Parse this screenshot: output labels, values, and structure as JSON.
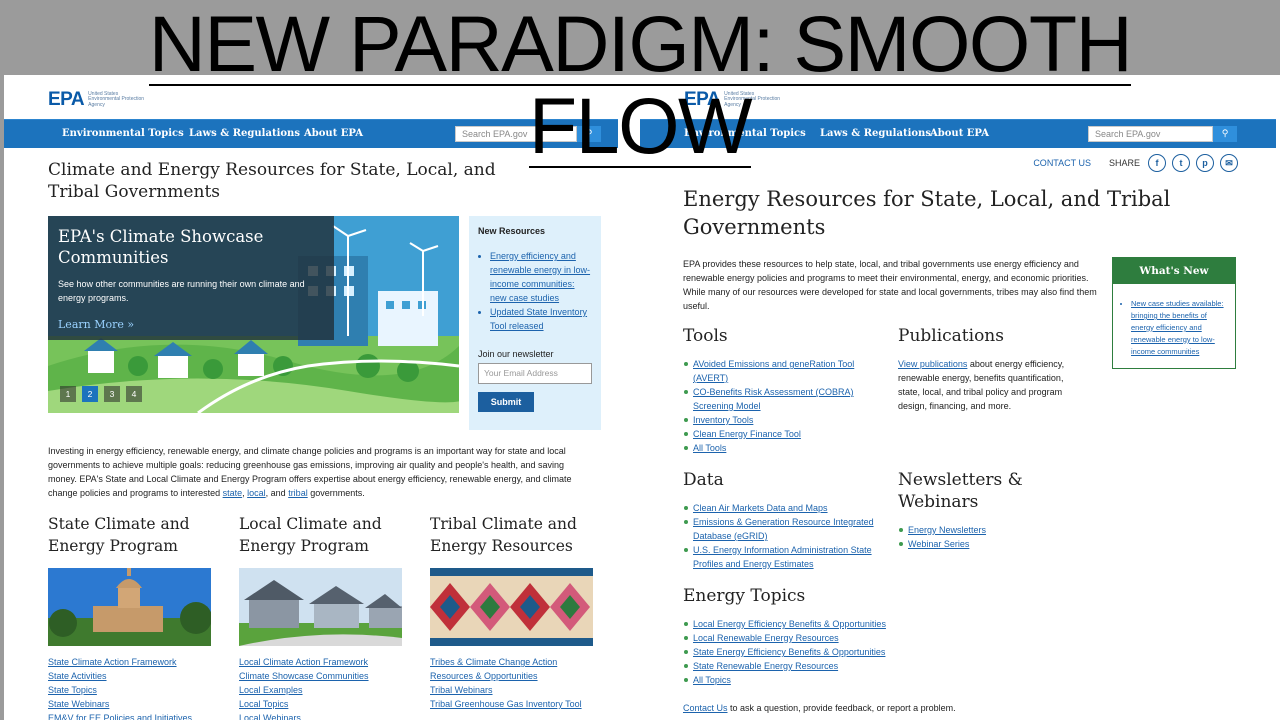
{
  "slide": {
    "title_line1": "NEW PARADIGM: SMOOTH",
    "title_line2": "FLOW"
  },
  "left_page": {
    "logo": {
      "mark": "EPA",
      "sub": "United States Environmental Protection Agency"
    },
    "nav": [
      "Environmental Topics",
      "Laws & Regulations",
      "About EPA"
    ],
    "search_placeholder": "Search EPA.gov",
    "title": "Climate and Energy Resources for State, Local, and Tribal Governments",
    "hero": {
      "title": "EPA's Climate Showcase Communities",
      "text": "See how other communities are running their own climate and energy programs.",
      "more": "Learn More »",
      "dots": [
        "1",
        "2",
        "3",
        "4"
      ],
      "active_dot": "2"
    },
    "new_resources": {
      "heading": "New Resources",
      "items": [
        "Energy efficiency and renewable energy in low-income communities: new case studies",
        "Updated State Inventory Tool released"
      ],
      "newsletter_label": "Join our newsletter",
      "email_placeholder": "Your Email Address",
      "submit": "Submit"
    },
    "intro": {
      "text": "Investing in energy efficiency, renewable energy, and climate change policies and programs is an important way for state and local governments to achieve multiple goals: reducing greenhouse gas emissions, improving air quality and people's health, and saving money. EPA's State and Local Climate and Energy Program offers expertise about energy efficiency, renewable energy, and climate change policies and programs to interested ",
      "link_state": "state",
      "sep1": ", ",
      "link_local": "local",
      "sep2": ", and ",
      "link_tribal": "tribal",
      "end": " governments."
    },
    "columns": [
      {
        "title": "State Climate and Energy Program",
        "links": [
          "State Climate Action Framework",
          "State Activities",
          "State Topics",
          "State Webinars",
          "EM&V for EE Policies and Initiatives"
        ]
      },
      {
        "title": "Local Climate and Energy Program",
        "links": [
          "Local Climate Action Framework",
          "Climate Showcase Communities",
          "Local Examples",
          "Local Topics",
          "Local Webinars"
        ]
      },
      {
        "title": "Tribal Climate and Energy Resources",
        "links": [
          "Tribes & Climate Change Action",
          "Resources & Opportunities",
          "Tribal Webinars",
          "Tribal Greenhouse Gas Inventory Tool"
        ]
      }
    ]
  },
  "right_page": {
    "logo": {
      "mark": "EPA",
      "sub": "United States Environmental Protection Agency"
    },
    "nav": [
      "Environmental Topics",
      "Laws & Regulations",
      "About EPA"
    ],
    "search_placeholder": "Search EPA.gov",
    "contact": "CONTACT US",
    "share": "SHARE",
    "share_icons": [
      "f",
      "t",
      "p",
      "✉"
    ],
    "title": "Energy Resources for State, Local, and Tribal Governments",
    "intro": "EPA provides these resources to help state, local, and tribal governments use energy efficiency and renewable energy policies and programs to meet their environmental, energy, and economic priorities. While many of our resources were developed for state and local governments, tribes may also find them useful.",
    "whats_new": {
      "heading": "What's New",
      "items": [
        "New case studies available: bringing the benefits of energy efficiency and renewable energy to low-income communities"
      ]
    },
    "tools": {
      "heading": "Tools",
      "links": [
        "AVoided Emissions and geneRation Tool (AVERT)",
        "CO-Benefits Risk Assessment (COBRA) Screening Model",
        "Inventory Tools",
        "Clean Energy Finance Tool",
        "All Tools"
      ]
    },
    "publications": {
      "heading": "Publications",
      "link": "View publications",
      "text": " about energy efficiency, renewable energy, benefits quantification, state, local, and tribal policy and program design, financing, and more."
    },
    "data": {
      "heading": "Data",
      "links": [
        "Clean Air Markets Data and Maps",
        "Emissions & Generation Resource Integrated Database (eGRID)",
        "U.S. Energy Information Administration State Profiles and Energy Estimates"
      ]
    },
    "newsletters": {
      "heading": "Newsletters & Webinars",
      "links": [
        "Energy Newsletters",
        "Webinar Series"
      ]
    },
    "energy_topics": {
      "heading": "Energy Topics",
      "links": [
        "Local Energy Efficiency Benefits & Opportunities",
        "Local Renewable Energy Resources",
        "State Energy Efficiency Benefits & Opportunities",
        "State Renewable Energy Resources",
        "All Topics"
      ]
    },
    "contact_line": {
      "link": "Contact Us",
      "text": " to ask a question, provide feedback, or report a problem."
    }
  }
}
